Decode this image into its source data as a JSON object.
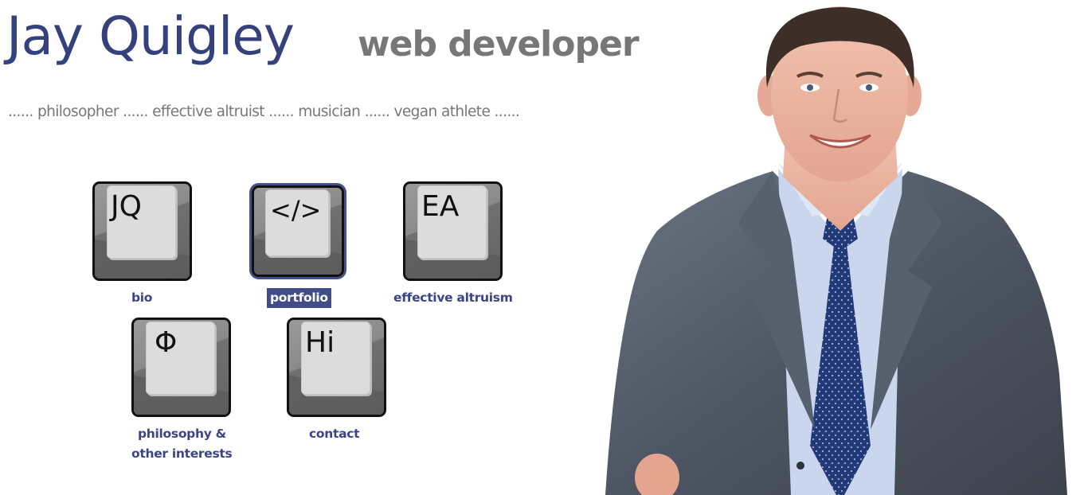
{
  "header": {
    "name": "Jay Quigley",
    "role": "web developer",
    "tagline": "...... philosopher ...... effective altruist ...... musician ...... vegan athlete ......"
  },
  "nav": {
    "items": [
      {
        "glyph": "JQ",
        "label": "bio",
        "icon": "jq-key-icon"
      },
      {
        "glyph": "</>",
        "label": "portfolio",
        "icon": "code-key-icon",
        "active": true
      },
      {
        "glyph": "EA",
        "label": "effective altruism",
        "icon": "ea-key-icon"
      },
      {
        "glyph": "Φ",
        "label_line1": "philosophy &",
        "label_line2": "other interests",
        "icon": "phi-key-icon"
      },
      {
        "glyph": "Hi",
        "label": "contact",
        "icon": "hi-key-icon"
      }
    ]
  },
  "colors": {
    "brand": "#34417c",
    "muted": "#777777",
    "highlight": "#424c86"
  }
}
